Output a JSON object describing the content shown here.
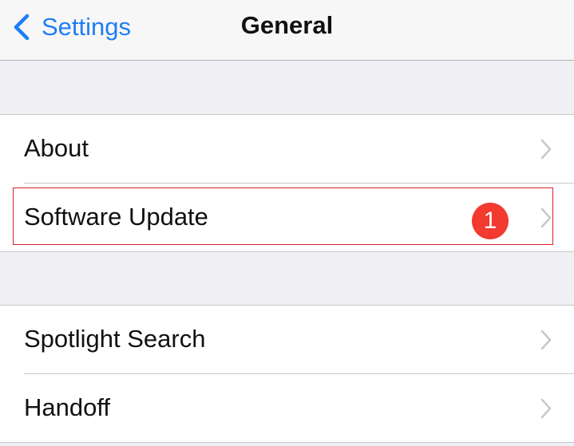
{
  "navbar": {
    "back_label": "Settings",
    "title": "General"
  },
  "groups": [
    {
      "items": [
        {
          "label": "About"
        },
        {
          "label": "Software Update",
          "badge": "1"
        }
      ]
    },
    {
      "items": [
        {
          "label": "Spotlight Search"
        },
        {
          "label": "Handoff"
        }
      ]
    }
  ],
  "colors": {
    "accent": "#1f7ef5",
    "badge": "#f23a2f",
    "highlight_outline": "#d9222a",
    "background": "#efeff4"
  }
}
